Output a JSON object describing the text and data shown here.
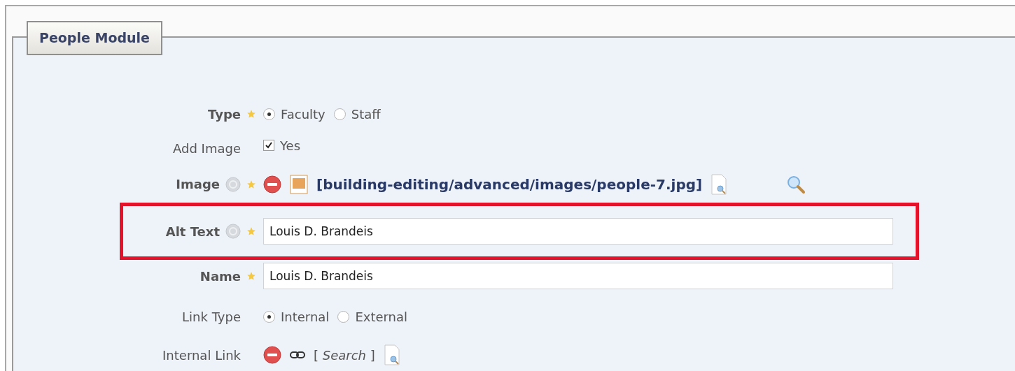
{
  "module": {
    "title": "People Module"
  },
  "fields": [
    {
      "kind": "radio",
      "label": "Type",
      "required": true,
      "help": false,
      "options": [
        {
          "label": "Faculty",
          "selected": true
        },
        {
          "label": "Staff",
          "selected": false
        }
      ]
    },
    {
      "kind": "checkbox",
      "label": "Add Image",
      "required": false,
      "help": false,
      "checked": true,
      "option": "Yes"
    },
    {
      "kind": "asset",
      "label": "Image",
      "required": true,
      "help": true,
      "value": "[building-editing/advanced/images/people-7.jpg]"
    },
    {
      "kind": "text",
      "label": "Alt Text",
      "required": true,
      "help": true,
      "highlighted": true,
      "value": "Louis D. Brandeis"
    },
    {
      "kind": "text",
      "label": "Name",
      "required": true,
      "help": false,
      "highlighted": false,
      "value": "Louis D. Brandeis"
    },
    {
      "kind": "radio",
      "label": "Link Type",
      "required": false,
      "help": false,
      "options": [
        {
          "label": "Internal",
          "selected": true
        },
        {
          "label": "External",
          "selected": false
        }
      ]
    },
    {
      "kind": "link",
      "label": "Internal Link",
      "required": false,
      "help": false,
      "value": "[ *Search* ]"
    }
  ]
}
